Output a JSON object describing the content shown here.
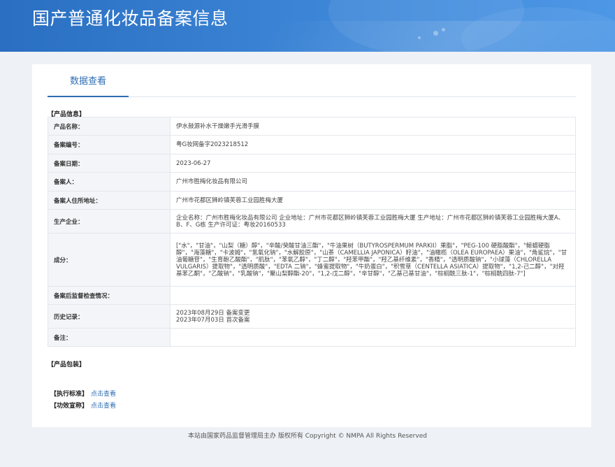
{
  "header": {
    "title": "国产普通化妆品备案信息"
  },
  "tabs": [
    {
      "label": "数据查看"
    }
  ],
  "sections": {
    "product_info": "【产品信息】",
    "product_package": "【产品包装】"
  },
  "product_info": {
    "rows": [
      {
        "key": "产品名称：",
        "value": "伊水鼓源补水干燥嫩手光滑手膜"
      },
      {
        "key": "备案编号：",
        "value": "粤G妆网备字2023218512"
      },
      {
        "key": "备案日期：",
        "value": "2023-06-27"
      },
      {
        "key": "备案人：",
        "value": "广州市胜梅化妆品有限公司"
      },
      {
        "key": "备案人住所地址：",
        "value": "广州市花都区狮岭镇芙蓉工业园胜梅大厦"
      },
      {
        "key": "生产企业：",
        "value": "企业名称：广州市胜梅化妆品有限公司 企业地址：广州市花都区狮岭镇芙蓉工业园胜梅大厦 生产地址：广州市花都区狮岭镇芙蓉工业园胜梅大厦A、B、F、G栋 生产许可证：粤妆20160533"
      },
      {
        "key": "成分：",
        "value": "[\"水\"，\"甘油\"，\"山梨（糖）醇\"，\"辛酸/癸酸甘油三酯\"，\"牛油果树（BUTYROSPERMUM PARKII）果脂\"，\"PEG-100 硬脂酸酯\"，\"鲸蜡硬脂醇\"，\"海藻糖\"，\"卡波姆\"，\"氢氧化钠\"，\"水解胶原\"，\"山茶（CAMELLIA JAPONICA）籽油\"，\"油橄榄（OLEA EUROPAEA）果油\"，\"角鲨烷\"，\"甘油葡糖苷\"，\"生育酚乙酸酯\"，\"肌肽\"，\"苯氧乙醇\"，\"丁二醇\"，\"羟苯甲酯\"，\"羟乙基纤维素\"，\"香精\"，\"透明质酸钠\"，\"小球藻（CHLORELLA VULGARIS）提取物\"，\"透明质酸\"，\"EDTA 二钠\"，\"蜂蜜提取物\"，\"牛奶蛋白\"，\"积雪草（CENTELLA ASIATICA）提取物\"，\"1,2-己二醇\"，\"对羟基苯乙酮\"，\"乙酸钠\"，\"乳酸钠\"，\"聚山梨醇酯-20\"，\"1,2-戊二醇\"，\"辛甘醇\"，\"乙基己基甘油\"，\"棕榈酰三肽-1\"，\"棕榈酰四肽-7\"]"
      },
      {
        "key": "备案后监督检查情况：",
        "value": ""
      },
      {
        "key": "历史记录：",
        "value_lines": [
          "2023年08月29日 备案变更",
          "2023年07月03日 首次备案"
        ]
      },
      {
        "key": "备注：",
        "value": ""
      }
    ]
  },
  "links": [
    {
      "label": "【执行标准】",
      "link_text": "点击查看"
    },
    {
      "label": "【功效宣称】",
      "link_text": "点击查看"
    }
  ],
  "footer": {
    "text": "本站由国家药品监督管理局主办 版权所有 Copyright © NMPA All Rights Reserved"
  },
  "colors": {
    "banner": "#2a6fc1",
    "link": "#2e6db3",
    "table_border": "#9fbad8"
  }
}
